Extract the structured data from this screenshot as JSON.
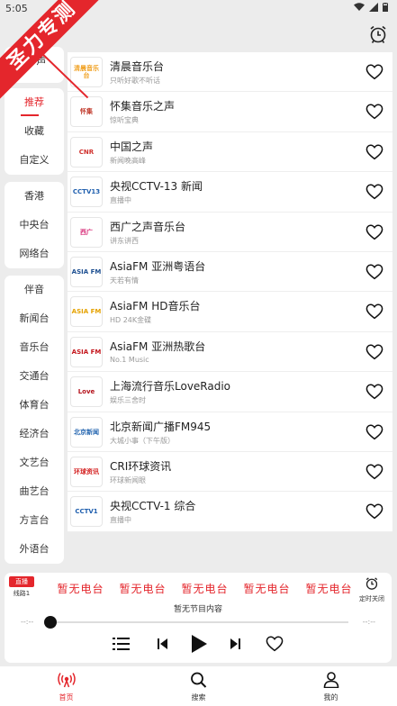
{
  "status": {
    "time": "5:05"
  },
  "corner_banner": "圣力专测",
  "sidebar": {
    "top_partial": "声",
    "group1": [
      "推荐",
      "收藏",
      "自定义"
    ],
    "group2": [
      "香港",
      "中央台",
      "网络台"
    ],
    "group3": [
      "伴音",
      "新闻台",
      "音乐台",
      "交通台",
      "体育台",
      "经济台",
      "文艺台",
      "曲艺台",
      "方言台",
      "外语台"
    ]
  },
  "stations": [
    {
      "name": "清晨音乐台",
      "sub": "只听好歌不听话",
      "logo_text": "清晨音乐台",
      "logo_color": "#f0a020"
    },
    {
      "name": "怀集音乐之声",
      "sub": "惊听宝典",
      "logo_text": "怀集",
      "logo_color": "#c0392b"
    },
    {
      "name": "中国之声",
      "sub": "新闻晚高峰",
      "logo_text": "CNR",
      "logo_color": "#d0312d"
    },
    {
      "name": "央视CCTV-13 新闻",
      "sub": "直播中",
      "logo_text": "CCTV13",
      "logo_color": "#1f5fae"
    },
    {
      "name": "西广之声音乐台",
      "sub": "讲东讲西",
      "logo_text": "西广",
      "logo_color": "#d8307a"
    },
    {
      "name": "AsiaFM 亚洲粤语台",
      "sub": "天若有情",
      "logo_text": "ASIA FM",
      "logo_color": "#1d4f91"
    },
    {
      "name": "AsiaFM HD音乐台",
      "sub": "HD 24K金碟",
      "logo_text": "ASIA FM",
      "logo_color": "#e5a200"
    },
    {
      "name": "AsiaFM 亚洲热歌台",
      "sub": "No.1 Music",
      "logo_text": "ASIA FM",
      "logo_color": "#c4161c"
    },
    {
      "name": "上海流行音乐LoveRadio",
      "sub": "娱乐三舍时",
      "logo_text": "Love",
      "logo_color": "#b4121b"
    },
    {
      "name": "北京新闻广播FM945",
      "sub": "大城小事（下午版）",
      "logo_text": "北京新闻",
      "logo_color": "#2566b0"
    },
    {
      "name": "CRI环球资讯",
      "sub": "环球新闻眼",
      "logo_text": "环球资讯",
      "logo_color": "#d42121"
    },
    {
      "name": "央视CCTV-1 综合",
      "sub": "直播中",
      "logo_text": "CCTV1",
      "logo_color": "#1f5fae"
    }
  ],
  "player": {
    "live_badge": "直播",
    "route": "线路1",
    "marquee": [
      "暂无电台",
      "暂无电台",
      "暂无电台",
      "暂无电台",
      "暂无电台"
    ],
    "timer_label": "定时关闭",
    "program": "暂无节目内容",
    "time_left": "--:--",
    "time_right": "--:--",
    "progress": 0
  },
  "nav": [
    {
      "label": "首页",
      "icon": "radio-icon",
      "active": true
    },
    {
      "label": "搜索",
      "icon": "search-icon",
      "active": false
    },
    {
      "label": "我的",
      "icon": "user-icon",
      "active": false
    }
  ],
  "colors": {
    "accent": "#e4262c",
    "background": "#ececec"
  }
}
